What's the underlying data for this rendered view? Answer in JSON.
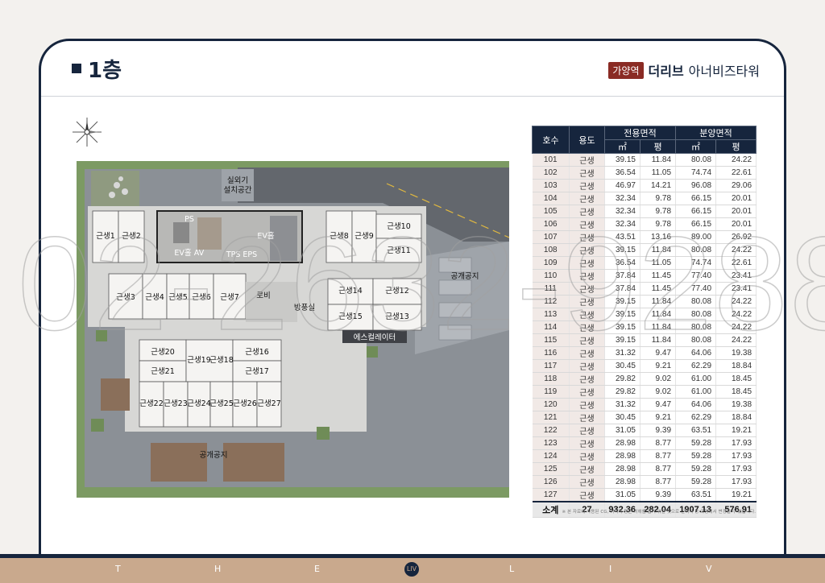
{
  "header": {
    "floor_title": "1층",
    "brand_tag": "가양역",
    "brand_bold": "더리브",
    "brand_rest": "아너비즈타워"
  },
  "watermark": "02-2632-9288",
  "plan": {
    "labels": {
      "outdoor_unit_1": "실외기",
      "outdoor_unit_2": "설치공간",
      "ps": "PS",
      "ev_hall_1": "EV홀",
      "av": "AV",
      "tps_eps": "TPS EPS",
      "ev_hall_2": "EV홀",
      "lobby": "로비",
      "disaster_room": "방풍실",
      "escalator": "에스컬레이터",
      "open_space_right": "공개공지",
      "open_space_bottom": "공개공지"
    },
    "units": {
      "u1": "근생1",
      "u2": "근생2",
      "u3": "근생3",
      "u4": "근생4",
      "u5": "근생5",
      "u6": "근생6",
      "u7": "근생7",
      "u8": "근생8",
      "u9": "근생9",
      "u10": "근생10",
      "u11": "근생11",
      "u12": "근생12",
      "u13": "근생13",
      "u14": "근생14",
      "u15": "근생15",
      "u16": "근생16",
      "u17": "근생17",
      "u18": "근생18",
      "u19": "근생19",
      "u20": "근생20",
      "u21": "근생21",
      "u22": "근생22",
      "u23": "근생23",
      "u24": "근생24",
      "u25": "근생25",
      "u26": "근생26",
      "u27": "근생27"
    }
  },
  "table": {
    "headers": {
      "unit_no": "호수",
      "use": "용도",
      "exclusive_area": "전용면적",
      "sale_area": "분양면적",
      "sqm": "㎡",
      "pyeong": "평"
    },
    "rows": [
      [
        "101",
        "근생",
        "39.15",
        "11.84",
        "80.08",
        "24.22"
      ],
      [
        "102",
        "근생",
        "36.54",
        "11.05",
        "74.74",
        "22.61"
      ],
      [
        "103",
        "근생",
        "46.97",
        "14.21",
        "96.08",
        "29.06"
      ],
      [
        "104",
        "근생",
        "32.34",
        "9.78",
        "66.15",
        "20.01"
      ],
      [
        "105",
        "근생",
        "32.34",
        "9.78",
        "66.15",
        "20.01"
      ],
      [
        "106",
        "근생",
        "32.34",
        "9.78",
        "66.15",
        "20.01"
      ],
      [
        "107",
        "근생",
        "43.51",
        "13.16",
        "89.00",
        "26.92"
      ],
      [
        "108",
        "근생",
        "39.15",
        "11.84",
        "80.08",
        "24.22"
      ],
      [
        "109",
        "근생",
        "36.54",
        "11.05",
        "74.74",
        "22.61"
      ],
      [
        "110",
        "근생",
        "37.84",
        "11.45",
        "77.40",
        "23.41"
      ],
      [
        "111",
        "근생",
        "37.84",
        "11.45",
        "77.40",
        "23.41"
      ],
      [
        "112",
        "근생",
        "39.15",
        "11.84",
        "80.08",
        "24.22"
      ],
      [
        "113",
        "근생",
        "39.15",
        "11.84",
        "80.08",
        "24.22"
      ],
      [
        "114",
        "근생",
        "39.15",
        "11.84",
        "80.08",
        "24.22"
      ],
      [
        "115",
        "근생",
        "39.15",
        "11.84",
        "80.08",
        "24.22"
      ],
      [
        "116",
        "근생",
        "31.32",
        "9.47",
        "64.06",
        "19.38"
      ],
      [
        "117",
        "근생",
        "30.45",
        "9.21",
        "62.29",
        "18.84"
      ],
      [
        "118",
        "근생",
        "29.82",
        "9.02",
        "61.00",
        "18.45"
      ],
      [
        "119",
        "근생",
        "29.82",
        "9.02",
        "61.00",
        "18.45"
      ],
      [
        "120",
        "근생",
        "31.32",
        "9.47",
        "64.06",
        "19.38"
      ],
      [
        "121",
        "근생",
        "30.45",
        "9.21",
        "62.29",
        "18.84"
      ],
      [
        "122",
        "근생",
        "31.05",
        "9.39",
        "63.51",
        "19.21"
      ],
      [
        "123",
        "근생",
        "28.98",
        "8.77",
        "59.28",
        "17.93"
      ],
      [
        "124",
        "근생",
        "28.98",
        "8.77",
        "59.28",
        "17.93"
      ],
      [
        "125",
        "근생",
        "28.98",
        "8.77",
        "59.28",
        "17.93"
      ],
      [
        "126",
        "근생",
        "28.98",
        "8.77",
        "59.28",
        "17.93"
      ],
      [
        "127",
        "근생",
        "31.05",
        "9.39",
        "63.51",
        "19.21"
      ]
    ],
    "total": {
      "label": "소계",
      "count": "27",
      "ex_sqm": "932.36",
      "ex_py": "282.04",
      "sale_sqm": "1907.13",
      "sale_py": "576.91"
    }
  },
  "note": "※ 본 자료에 사용된 CG, 이미지 등은 이해를 돕기 위한 것으로 인허가 등 과정에서 변경될 수 있습니다.",
  "footer": {
    "letters": [
      "T",
      "H",
      "E",
      "L",
      "I",
      "V"
    ],
    "logo": "LIV"
  },
  "colors": {
    "navy": "#16253d",
    "accent_red": "#8a2b24",
    "footer_tan": "#c9a98d",
    "table_stripe": "#f1e9e6"
  }
}
